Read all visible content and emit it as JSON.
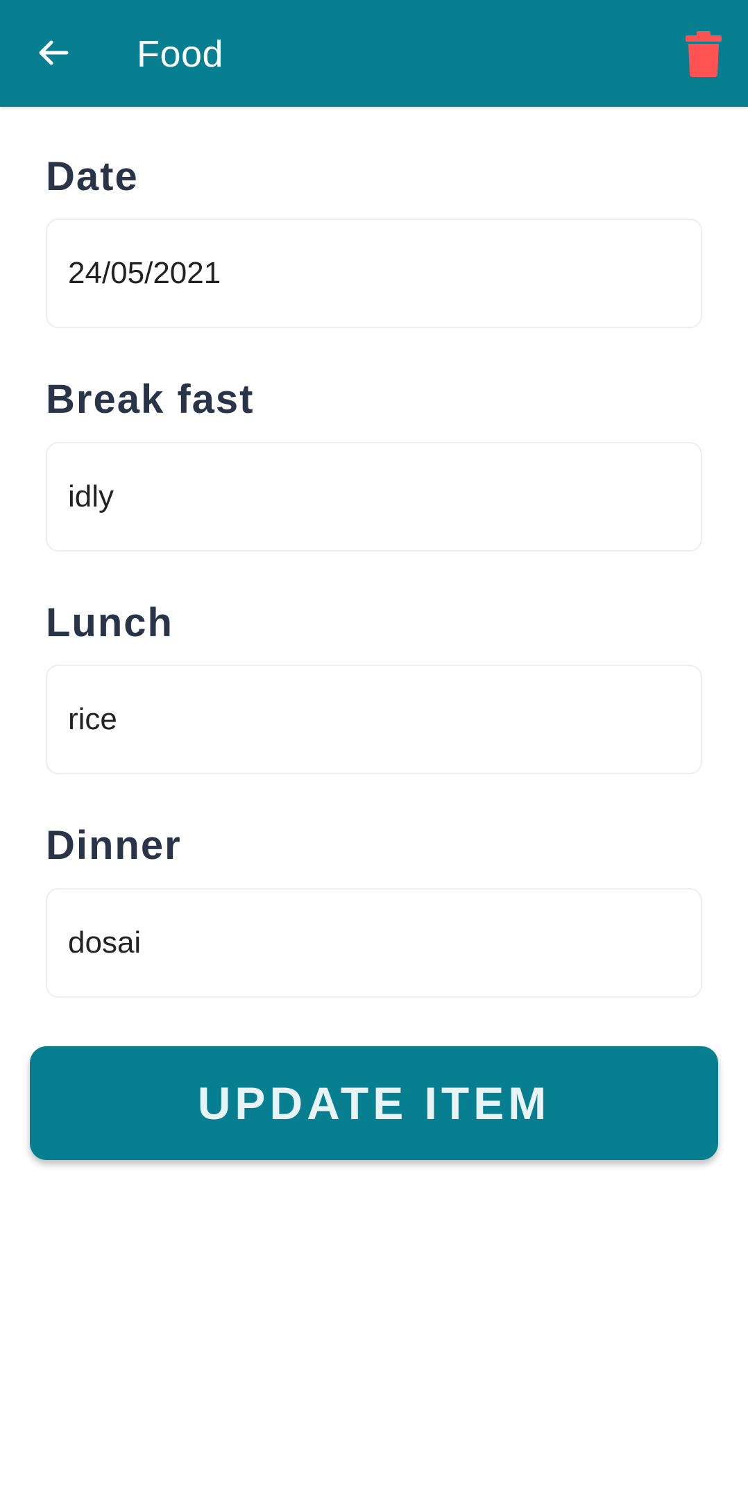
{
  "app_bar": {
    "title": "Food",
    "back_icon": "arrow-left-icon",
    "delete_icon": "trash-icon",
    "color": "#077f91",
    "delete_color": "#ff5252"
  },
  "form": {
    "date": {
      "label": "Date",
      "value": "24/05/2021"
    },
    "breakfast": {
      "label": "Break fast",
      "value": "idly"
    },
    "lunch": {
      "label": "Lunch",
      "value": "rice"
    },
    "dinner": {
      "label": "Dinner",
      "value": "dosai"
    }
  },
  "update_button": {
    "label": "UPDATE ITEM"
  }
}
